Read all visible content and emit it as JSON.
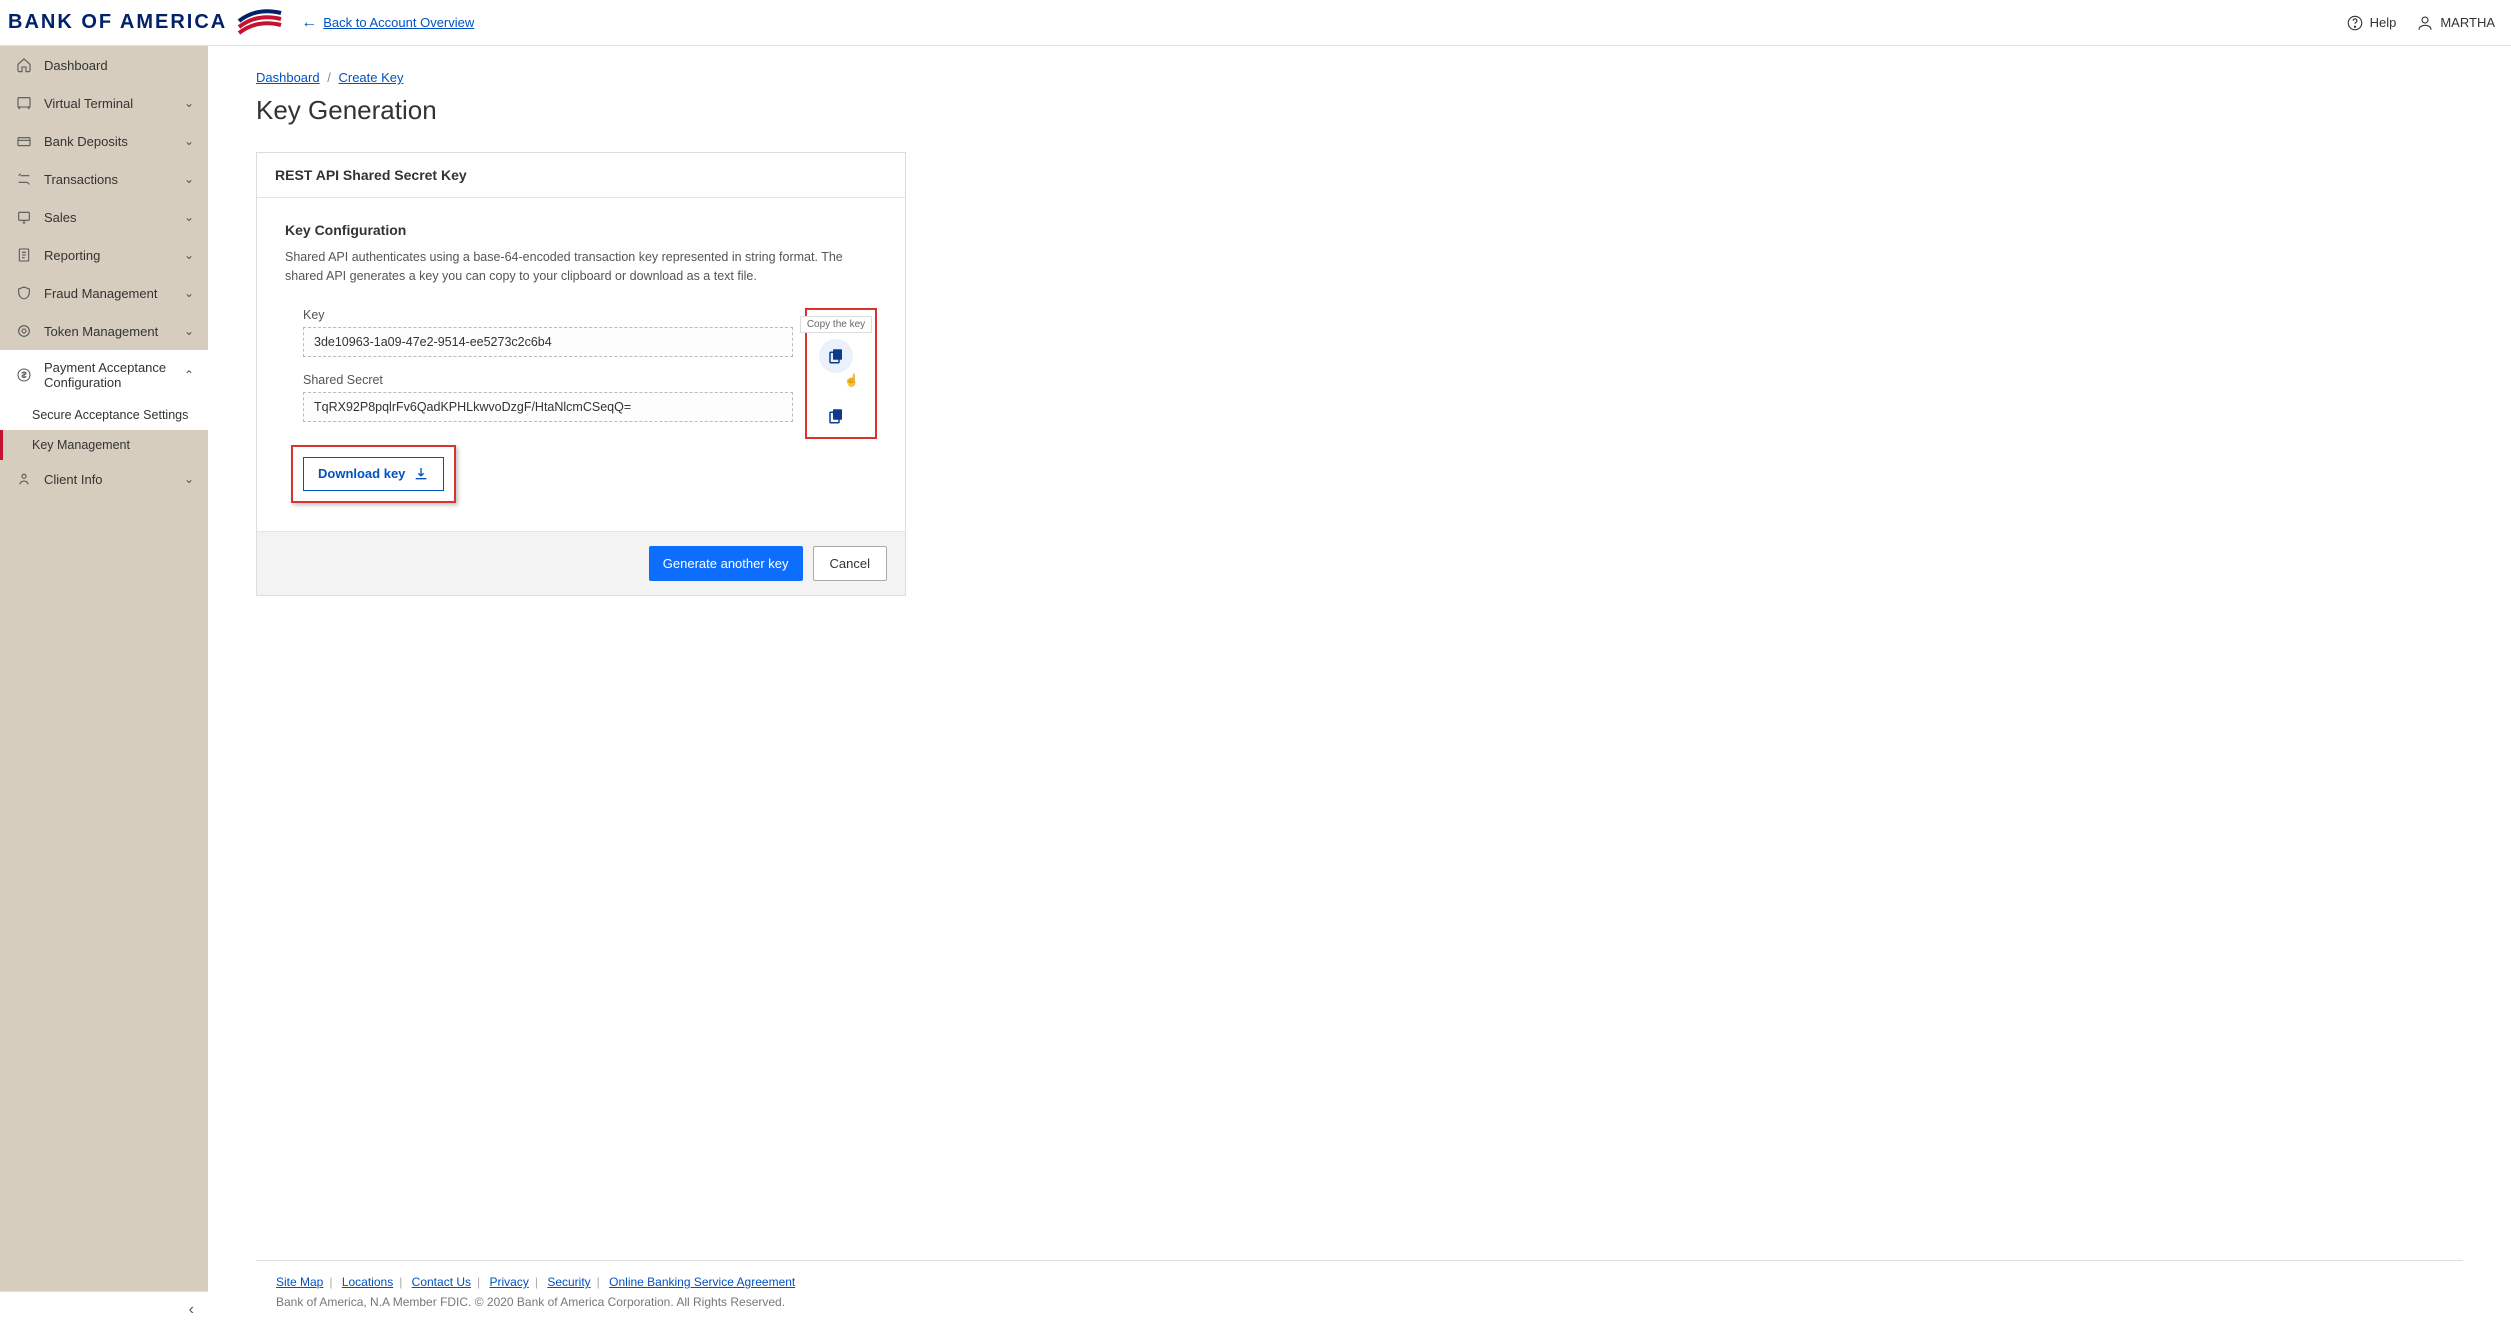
{
  "header": {
    "brand": "BANK OF AMERICA",
    "back_link": "Back to Account Overview",
    "help_label": "Help",
    "user_name": "MARTHA"
  },
  "sidebar": {
    "items": [
      {
        "label": "Dashboard",
        "expandable": false
      },
      {
        "label": "Virtual Terminal",
        "expandable": true
      },
      {
        "label": "Bank Deposits",
        "expandable": true
      },
      {
        "label": "Transactions",
        "expandable": true
      },
      {
        "label": "Sales",
        "expandable": true
      },
      {
        "label": "Reporting",
        "expandable": true
      },
      {
        "label": "Fraud Management",
        "expandable": true
      },
      {
        "label": "Token Management",
        "expandable": true
      },
      {
        "label": "Payment Acceptance Configuration",
        "expandable": true,
        "expanded": true
      },
      {
        "label": "Client Info",
        "expandable": true
      }
    ],
    "sub_items": {
      "secure_acceptance": "Secure Acceptance Settings",
      "key_management": "Key Management"
    }
  },
  "breadcrumb": {
    "dashboard": "Dashboard",
    "create_key": "Create Key"
  },
  "page": {
    "title": "Key Generation",
    "card_header": "REST API Shared Secret Key",
    "section_title": "Key Configuration",
    "section_desc": "Shared API authenticates using a base-64-encoded transaction key represented in string format. The shared API generates a key you can copy to your clipboard or download as a text file.",
    "key_label": "Key",
    "key_value": "3de10963-1a09-47e2-9514-ee5273c2c6b4",
    "secret_label": "Shared Secret",
    "secret_value": "TqRX92P8pqlrFv6QadKPHLkwvoDzgF/HtaNlcmCSeqQ=",
    "copy_tip": "Copy the key",
    "download_label": "Download key",
    "generate_label": "Generate another key",
    "cancel_label": "Cancel"
  },
  "footer": {
    "links": {
      "site_map": "Site Map",
      "locations": "Locations",
      "contact": "Contact Us",
      "privacy": "Privacy",
      "security": "Security",
      "agreement": "Online Banking Service Agreement"
    },
    "copy": "Bank of America, N.A Member FDIC. © 2020 Bank of America Corporation. All Rights Reserved."
  }
}
